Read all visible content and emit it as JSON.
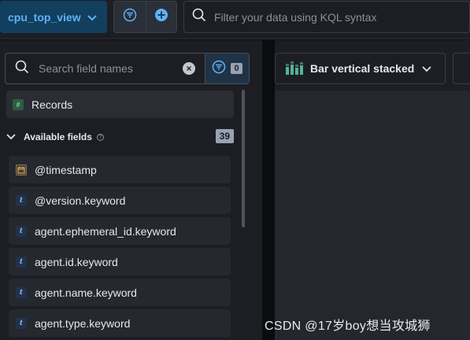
{
  "topbar": {
    "data_view": "cpu_top_view",
    "query_placeholder": "Filter your data using KQL syntax"
  },
  "sidebar": {
    "search_placeholder": "Search field names",
    "filter_count": "0",
    "records_label": "Records",
    "available_fields_label": "Available fields",
    "available_fields_count": "39",
    "fields": [
      {
        "name": "@timestamp",
        "type": "date"
      },
      {
        "name": "@version.keyword",
        "type": "text"
      },
      {
        "name": "agent.ephemeral_id.keyword",
        "type": "text"
      },
      {
        "name": "agent.id.keyword",
        "type": "text"
      },
      {
        "name": "agent.name.keyword",
        "type": "text"
      },
      {
        "name": "agent.type.keyword",
        "type": "text"
      }
    ]
  },
  "workspace": {
    "chart_type_label": "Bar vertical stacked"
  },
  "watermark": "CSDN @17岁boy想当攻城狮",
  "colors": {
    "accent": "#5fb2f7",
    "background": "#1d1e24",
    "page": "#0b0c10"
  }
}
